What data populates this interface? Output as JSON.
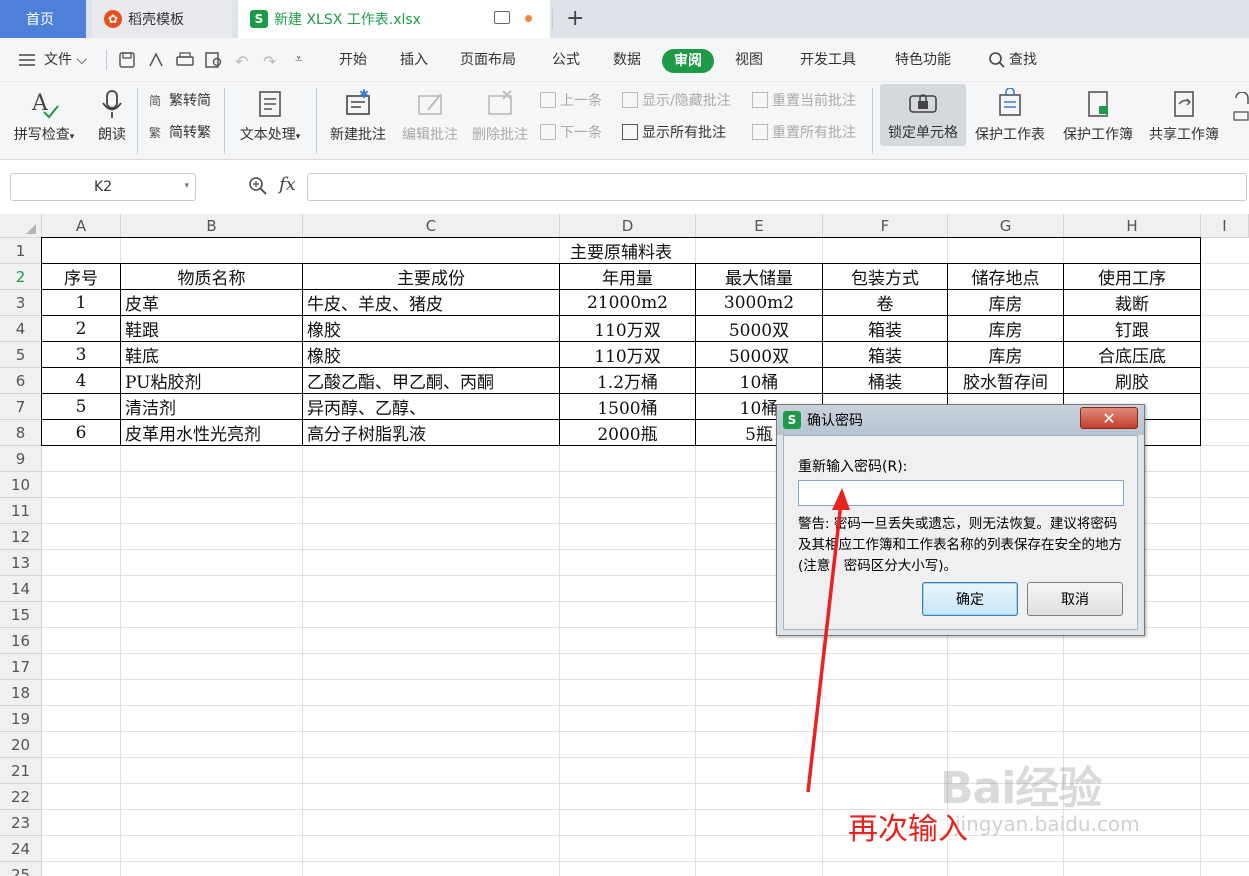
{
  "tabs": {
    "home": "首页",
    "docer": "稻壳模板",
    "document": "新建 XLSX 工作表.xlsx",
    "document_icon": "S",
    "new_tab": "+"
  },
  "menu": {
    "file": "文件",
    "items": [
      "开始",
      "插入",
      "页面布局",
      "公式",
      "数据",
      "审阅",
      "视图",
      "开发工具",
      "特色功能"
    ],
    "active": "审阅",
    "search": "查找"
  },
  "ribbon": {
    "spell_check": "拼写检查",
    "read_aloud": "朗读",
    "trad_to_simp": "繁转简",
    "simp_to_trad": "简转繁",
    "text_processing": "文本处理",
    "new_comment": "新建批注",
    "edit_comment": "编辑批注",
    "delete_comment": "删除批注",
    "prev": "上一条",
    "next": "下一条",
    "show_hide_comment": "显示/隐藏批注",
    "show_all_comments": "显示所有批注",
    "reset_current_comment": "重置当前批注",
    "reset_all_comments": "重置所有批注",
    "lock_cells": "锁定单元格",
    "protect_sheet": "保护工作表",
    "protect_workbook": "保护工作簿",
    "share_workbook": "共享工作簿"
  },
  "formula_bar": {
    "name_box": "K2",
    "fx": "fx",
    "value": ""
  },
  "columns": [
    "A",
    "B",
    "C",
    "D",
    "E",
    "F",
    "G",
    "H",
    "I"
  ],
  "rows": [
    "1",
    "2",
    "3",
    "4",
    "5",
    "6",
    "7",
    "8",
    "9",
    "10",
    "11",
    "12",
    "13",
    "14",
    "15",
    "16",
    "17",
    "18",
    "19",
    "20",
    "21",
    "22",
    "23",
    "24",
    "25"
  ],
  "sheet": {
    "title": "主要原辅料表",
    "headers": [
      "序号",
      "物质名称",
      "主要成份",
      "年用量",
      "最大储量",
      "包装方式",
      "储存地点",
      "使用工序"
    ],
    "data": [
      [
        "1",
        "皮革",
        "牛皮、羊皮、猪皮",
        "21000m2",
        "3000m2",
        "卷",
        "库房",
        "裁断"
      ],
      [
        "2",
        "鞋跟",
        "橡胶",
        "110万双",
        "5000双",
        "箱装",
        "库房",
        "钉跟"
      ],
      [
        "3",
        "鞋底",
        "橡胶",
        "110万双",
        "5000双",
        "箱装",
        "库房",
        "合底压底"
      ],
      [
        "4",
        "PU粘胶剂",
        "乙酸乙酯、甲乙酮、丙酮",
        "1.2万桶",
        "10桶",
        "桶装",
        "胶水暂存间",
        "刷胶"
      ],
      [
        "5",
        "清洁剂",
        "异丙醇、乙醇、",
        "1500桶",
        "10桶",
        "",
        "",
        ""
      ],
      [
        "6",
        "皮革用水性光亮剂",
        "高分子树脂乳液",
        "2000瓶",
        "5瓶",
        "",
        "",
        ""
      ]
    ]
  },
  "dialog": {
    "title": "确认密码",
    "icon": "S",
    "close": "✕",
    "label": "重新输入密码(R):",
    "input_value": "",
    "warning": "警告: 密码一旦丢失或遗忘，则无法恢复。建议将密码及其相应工作簿和工作表名称的列表保存在安全的地方(注意，密码区分大小写)。",
    "ok": "确定",
    "cancel": "取消"
  },
  "annotation": "再次输入",
  "watermark": {
    "main": "Bai经验",
    "sub": "jingyan.baidu.com"
  },
  "colors": {
    "accent_green": "#1d9a48",
    "home_tab": "#4e7fd9",
    "docer_orange": "#e8501d",
    "annotation_red": "#e8231f",
    "dialog_close": "#c43f2c"
  }
}
